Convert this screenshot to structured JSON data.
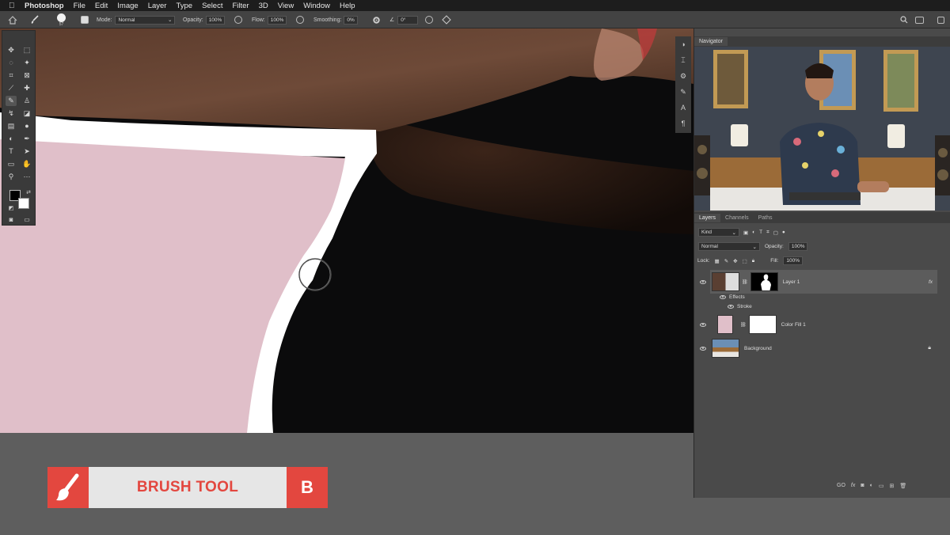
{
  "menubar": {
    "app": "Photoshop",
    "items": [
      "File",
      "Edit",
      "Image",
      "Layer",
      "Type",
      "Select",
      "Filter",
      "3D",
      "View",
      "Window",
      "Help"
    ]
  },
  "options": {
    "brush_size": "57",
    "mode_label": "Mode:",
    "mode_value": "Normal",
    "opacity_label": "Opacity:",
    "opacity_value": "100%",
    "flow_label": "Flow:",
    "flow_value": "100%",
    "smoothing_label": "Smoothing:",
    "smoothing_value": "0%",
    "angle_value": "0°"
  },
  "navigator": {
    "tab": "Navigator"
  },
  "layers": {
    "tabs": [
      "Layers",
      "Channels",
      "Paths"
    ],
    "kind_label": "Kind",
    "blend_mode": "Normal",
    "opacity_label": "Opacity:",
    "opacity_value": "100%",
    "lock_label": "Lock:",
    "fill_label": "Fill:",
    "fill_value": "100%",
    "list": [
      {
        "name": "Layer 1",
        "effects": "Effects",
        "stroke": "Stroke",
        "fx": "fx"
      },
      {
        "name": "Color Fill 1"
      },
      {
        "name": "Background"
      }
    ]
  },
  "bottom_icons": [
    "GO",
    "fx"
  ],
  "banner": {
    "label": "BRUSH TOOL",
    "shortcut": "B"
  },
  "colors": {
    "accent": "#e3473f",
    "fill_pink": "#e0bfc9"
  }
}
